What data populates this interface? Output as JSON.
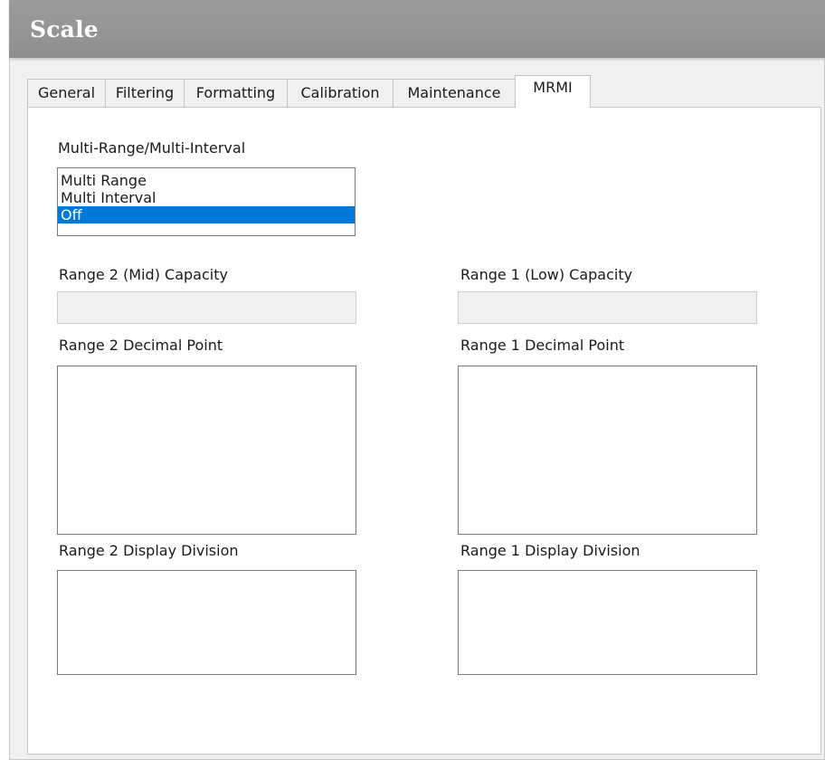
{
  "window": {
    "title": "Scale"
  },
  "tabs": [
    {
      "label": "General"
    },
    {
      "label": "Filtering"
    },
    {
      "label": "Formatting"
    },
    {
      "label": "Calibration"
    },
    {
      "label": "Maintenance"
    },
    {
      "label": "MRMI",
      "active": true
    }
  ],
  "mrmi": {
    "mode_label": "Multi-Range/Multi-Interval",
    "mode_options": [
      "Multi Range",
      "Multi Interval",
      "Off"
    ],
    "mode_selected": "Off",
    "range2_capacity_label": "Range 2 (Mid) Capacity",
    "range2_capacity_value": "",
    "range1_capacity_label": "Range 1 (Low) Capacity",
    "range1_capacity_value": "",
    "range2_decimal_label": "Range 2 Decimal Point",
    "range1_decimal_label": "Range 1 Decimal Point",
    "range2_division_label": "Range 2 Display Division",
    "range1_division_label": "Range 1 Display Division"
  },
  "colors": {
    "titlebar": "#959595",
    "selection": "#0078d7"
  }
}
